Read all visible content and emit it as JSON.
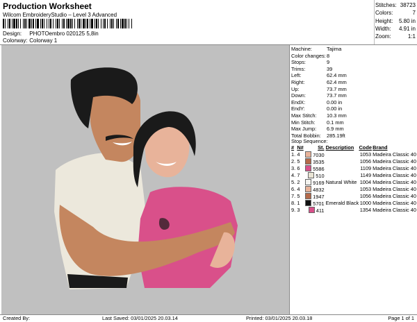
{
  "header": {
    "title": "Production Worksheet",
    "subtitle": "Wilcom EmbroideryStudio – Level 3 Advanced",
    "design_label": "Design:",
    "design_value": "PHOTOembro 020125 5,8in",
    "colorway_label": "Colorway:",
    "colorway_value": "Colorway 1"
  },
  "summary": [
    {
      "label": "Stitches:",
      "value": "38723"
    },
    {
      "label": "Colors:",
      "value": "7"
    },
    {
      "label": "Height:",
      "value": "5.80 in"
    },
    {
      "label": "Width:",
      "value": "4.91 in"
    },
    {
      "label": "Zoom:",
      "value": "1:1"
    }
  ],
  "machine_info": [
    {
      "label": "Machine:",
      "value": "Tajima"
    },
    {
      "label": "Color changes:",
      "value": "8"
    },
    {
      "label": "Stops:",
      "value": "9"
    },
    {
      "label": "Trims:",
      "value": "39"
    },
    {
      "label": "Left:",
      "value": "62.4 mm"
    },
    {
      "label": "Right:",
      "value": "62.4 mm"
    },
    {
      "label": "Up:",
      "value": "73.7 mm"
    },
    {
      "label": "Down:",
      "value": "73.7 mm"
    },
    {
      "label": "EndX:",
      "value": "0.00 in"
    },
    {
      "label": "EndY:",
      "value": "0.00 in"
    },
    {
      "label": "Max Stitch:",
      "value": "10.3 mm"
    },
    {
      "label": "Min Stitch:",
      "value": "0.1 mm"
    },
    {
      "label": "Max Jump:",
      "value": "6.9 mm"
    },
    {
      "label": "Total Bobbin:",
      "value": "285.19ft"
    }
  ],
  "stop_sequence": {
    "title": "Stop Sequence:",
    "columns": [
      "#",
      "N#",
      "St.",
      "Description",
      "Code",
      "Brand"
    ],
    "rows": [
      {
        "num": "1.",
        "n": "4",
        "color": "#e8b39a",
        "st": "7030",
        "desc": "",
        "code": "1053",
        "brand": "Madeira Classic 40"
      },
      {
        "num": "2.",
        "n": "5",
        "color": "#b56a4a",
        "st": "3535",
        "desc": "",
        "code": "1056",
        "brand": "Madeira Classic 40"
      },
      {
        "num": "3.",
        "n": "6",
        "color": "#d9508a",
        "st": "5586",
        "desc": "",
        "code": "1109",
        "brand": "Madeira Classic 40"
      },
      {
        "num": "4.",
        "n": "7",
        "color": "#e9e4d4",
        "st": "510",
        "desc": "",
        "code": "1149",
        "brand": "Madeira Classic 40"
      },
      {
        "num": "5.",
        "n": "2",
        "color": "#f4f4f0",
        "st": "9169",
        "desc": "Natural White",
        "code": "1004",
        "brand": "Madeira Classic 40"
      },
      {
        "num": "6.",
        "n": "4",
        "color": "#e8b39a",
        "st": "4832",
        "desc": "",
        "code": "1053",
        "brand": "Madeira Classic 40"
      },
      {
        "num": "7.",
        "n": "5",
        "color": "#b56a4a",
        "st": "1947",
        "desc": "",
        "code": "1056",
        "brand": "Madeira Classic 40"
      },
      {
        "num": "8.",
        "n": "1",
        "color": "#111111",
        "st": "5701",
        "desc": "Emerald Black",
        "code": "1000",
        "brand": "Madeira Classic 40"
      },
      {
        "num": "9.",
        "n": "3",
        "color": "#d9508a",
        "st": "411",
        "desc": "",
        "code": "1354",
        "brand": "Madeira Classic 40"
      }
    ]
  },
  "footer": {
    "created_by": "Created By:",
    "last_saved": "Last Saved: 03/01/2025 20.03.14",
    "printed": "Printed: 03/01/2025 20.03.18",
    "page": "Page 1 of 1"
  },
  "colors": {
    "canvas_bg": "#c0c0c0",
    "skin_man": "#c4865f",
    "skin_woman": "#e8b39a",
    "shirt_man": "#ece8dc",
    "shirt_woman": "#d9508a",
    "hair": "#1a1a1a"
  }
}
